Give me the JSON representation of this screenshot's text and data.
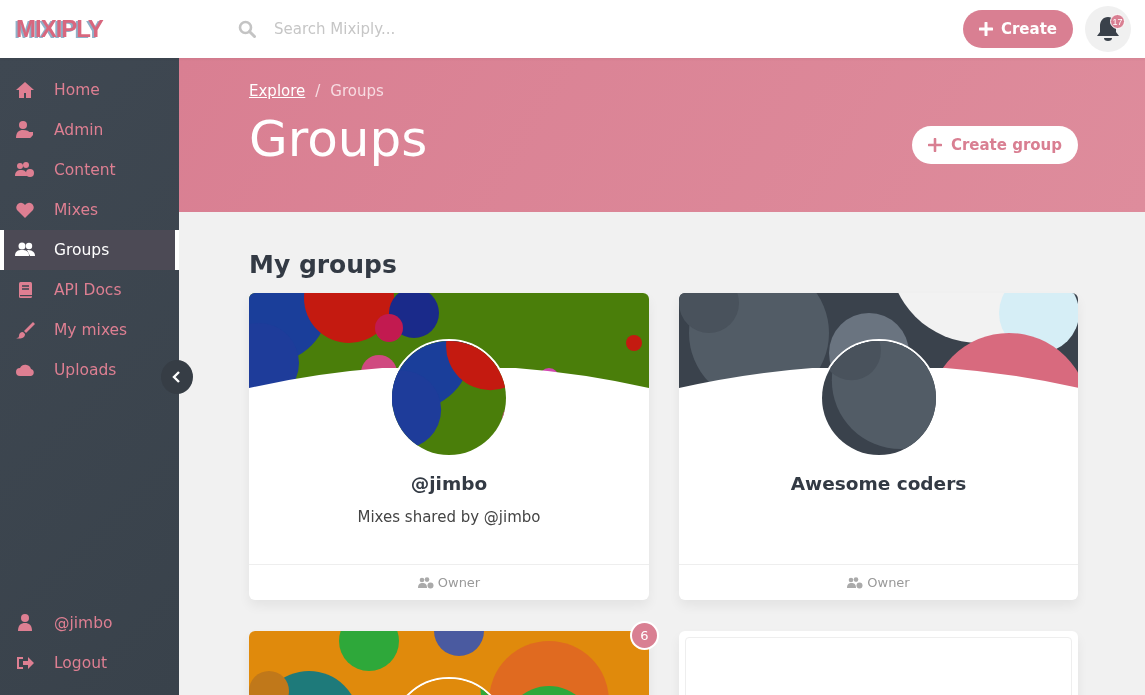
{
  "header": {
    "logo": "MIXIPLY",
    "search": {
      "placeholder": "Search Mixiply..."
    },
    "create_button": "Create",
    "notifications": {
      "count": "17"
    }
  },
  "sidebar": {
    "items": [
      {
        "label": "Home",
        "selected": false
      },
      {
        "label": "Admin",
        "selected": false
      },
      {
        "label": "Content",
        "selected": false
      },
      {
        "label": "Mixes",
        "selected": false
      },
      {
        "label": "Groups",
        "selected": true
      },
      {
        "label": "API Docs",
        "selected": false
      },
      {
        "label": "My mixes",
        "selected": false
      },
      {
        "label": "Uploads",
        "selected": false
      }
    ],
    "bottom_items": [
      {
        "label": "@jimbo"
      },
      {
        "label": "Logout"
      }
    ]
  },
  "banner": {
    "breadcrumb": [
      {
        "label": "Explore",
        "link": true
      },
      {
        "label": "Groups",
        "link": false
      }
    ],
    "breadcrumb_separator": "/",
    "title": "Groups",
    "create_group_button": "Create group"
  },
  "section_title": "My groups",
  "groups": [
    {
      "kind": "picture",
      "name": "@jimbo",
      "description": "Mixes shared by @jimbo",
      "role": "Owner"
    },
    {
      "kind": "picture",
      "name": "Awesome coders",
      "role": "Owner"
    },
    {
      "kind": "picture",
      "badge": "6"
    },
    {
      "kind": "blank"
    }
  ]
}
